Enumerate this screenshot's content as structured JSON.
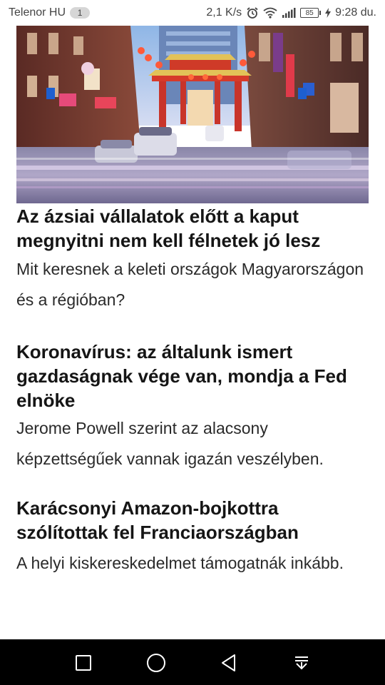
{
  "status_bar": {
    "carrier": "Telenor HU",
    "notification_count": "1",
    "network_speed": "2,1 K/s",
    "battery_level": "85",
    "time": "9:28 du.",
    "icons": [
      "alarm-icon",
      "wifi-icon",
      "signal-icon",
      "battery-icon",
      "charging-icon"
    ]
  },
  "hero_image": {
    "description_icon": "photo"
  },
  "articles": [
    {
      "title": "Az ázsiai vállalatok előtt a kaput megnyitni nem kell félnetek jó lesz",
      "summary": "Mit keresnek a keleti országok Magyarországon és a régióban?"
    },
    {
      "title": "Koronavírus: az általunk ismert gazdaságnak vége van, mondja a Fed elnöke",
      "summary": "Jerome Powell szerint az alacsony képzettségűek vannak igazán veszélyben."
    },
    {
      "title": "Karácsonyi Amazon-bojkottra szólítottak fel Franciaországban",
      "summary": "A helyi kiskereskedelmet támogatnák inkább."
    }
  ],
  "nav_bar": {
    "icons": [
      "recents-square-icon",
      "home-circle-icon",
      "back-triangle-icon",
      "notification-pulldown-icon"
    ]
  },
  "colors": {
    "nav_background": "#000000",
    "text_primary": "#151515",
    "status_text": "#444444"
  }
}
